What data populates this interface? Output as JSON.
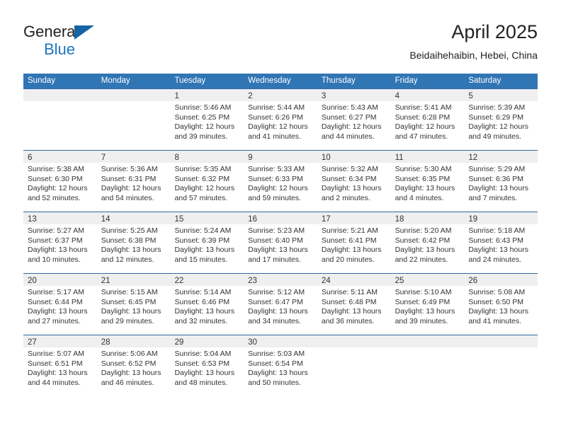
{
  "brand": {
    "name_part1": "General",
    "name_part2": "Blue",
    "triangle_color": "#1464a5",
    "blue_color": "#1c75bc"
  },
  "header": {
    "title": "April 2025",
    "subtitle": "Beidaihehaibin, Hebei, China",
    "header_bg": "#3075b4",
    "separator_color": "#2e6da4",
    "daynum_band_bg": "#efefef"
  },
  "weekdays": [
    "Sunday",
    "Monday",
    "Tuesday",
    "Wednesday",
    "Thursday",
    "Friday",
    "Saturday"
  ],
  "weeks": [
    [
      {
        "day": "",
        "lines": []
      },
      {
        "day": "",
        "lines": []
      },
      {
        "day": "1",
        "lines": [
          "Sunrise: 5:46 AM",
          "Sunset: 6:25 PM",
          "Daylight: 12 hours",
          "and 39 minutes."
        ]
      },
      {
        "day": "2",
        "lines": [
          "Sunrise: 5:44 AM",
          "Sunset: 6:26 PM",
          "Daylight: 12 hours",
          "and 41 minutes."
        ]
      },
      {
        "day": "3",
        "lines": [
          "Sunrise: 5:43 AM",
          "Sunset: 6:27 PM",
          "Daylight: 12 hours",
          "and 44 minutes."
        ]
      },
      {
        "day": "4",
        "lines": [
          "Sunrise: 5:41 AM",
          "Sunset: 6:28 PM",
          "Daylight: 12 hours",
          "and 47 minutes."
        ]
      },
      {
        "day": "5",
        "lines": [
          "Sunrise: 5:39 AM",
          "Sunset: 6:29 PM",
          "Daylight: 12 hours",
          "and 49 minutes."
        ]
      }
    ],
    [
      {
        "day": "6",
        "lines": [
          "Sunrise: 5:38 AM",
          "Sunset: 6:30 PM",
          "Daylight: 12 hours",
          "and 52 minutes."
        ]
      },
      {
        "day": "7",
        "lines": [
          "Sunrise: 5:36 AM",
          "Sunset: 6:31 PM",
          "Daylight: 12 hours",
          "and 54 minutes."
        ]
      },
      {
        "day": "8",
        "lines": [
          "Sunrise: 5:35 AM",
          "Sunset: 6:32 PM",
          "Daylight: 12 hours",
          "and 57 minutes."
        ]
      },
      {
        "day": "9",
        "lines": [
          "Sunrise: 5:33 AM",
          "Sunset: 6:33 PM",
          "Daylight: 12 hours",
          "and 59 minutes."
        ]
      },
      {
        "day": "10",
        "lines": [
          "Sunrise: 5:32 AM",
          "Sunset: 6:34 PM",
          "Daylight: 13 hours",
          "and 2 minutes."
        ]
      },
      {
        "day": "11",
        "lines": [
          "Sunrise: 5:30 AM",
          "Sunset: 6:35 PM",
          "Daylight: 13 hours",
          "and 4 minutes."
        ]
      },
      {
        "day": "12",
        "lines": [
          "Sunrise: 5:29 AM",
          "Sunset: 6:36 PM",
          "Daylight: 13 hours",
          "and 7 minutes."
        ]
      }
    ],
    [
      {
        "day": "13",
        "lines": [
          "Sunrise: 5:27 AM",
          "Sunset: 6:37 PM",
          "Daylight: 13 hours",
          "and 10 minutes."
        ]
      },
      {
        "day": "14",
        "lines": [
          "Sunrise: 5:25 AM",
          "Sunset: 6:38 PM",
          "Daylight: 13 hours",
          "and 12 minutes."
        ]
      },
      {
        "day": "15",
        "lines": [
          "Sunrise: 5:24 AM",
          "Sunset: 6:39 PM",
          "Daylight: 13 hours",
          "and 15 minutes."
        ]
      },
      {
        "day": "16",
        "lines": [
          "Sunrise: 5:23 AM",
          "Sunset: 6:40 PM",
          "Daylight: 13 hours",
          "and 17 minutes."
        ]
      },
      {
        "day": "17",
        "lines": [
          "Sunrise: 5:21 AM",
          "Sunset: 6:41 PM",
          "Daylight: 13 hours",
          "and 20 minutes."
        ]
      },
      {
        "day": "18",
        "lines": [
          "Sunrise: 5:20 AM",
          "Sunset: 6:42 PM",
          "Daylight: 13 hours",
          "and 22 minutes."
        ]
      },
      {
        "day": "19",
        "lines": [
          "Sunrise: 5:18 AM",
          "Sunset: 6:43 PM",
          "Daylight: 13 hours",
          "and 24 minutes."
        ]
      }
    ],
    [
      {
        "day": "20",
        "lines": [
          "Sunrise: 5:17 AM",
          "Sunset: 6:44 PM",
          "Daylight: 13 hours",
          "and 27 minutes."
        ]
      },
      {
        "day": "21",
        "lines": [
          "Sunrise: 5:15 AM",
          "Sunset: 6:45 PM",
          "Daylight: 13 hours",
          "and 29 minutes."
        ]
      },
      {
        "day": "22",
        "lines": [
          "Sunrise: 5:14 AM",
          "Sunset: 6:46 PM",
          "Daylight: 13 hours",
          "and 32 minutes."
        ]
      },
      {
        "day": "23",
        "lines": [
          "Sunrise: 5:12 AM",
          "Sunset: 6:47 PM",
          "Daylight: 13 hours",
          "and 34 minutes."
        ]
      },
      {
        "day": "24",
        "lines": [
          "Sunrise: 5:11 AM",
          "Sunset: 6:48 PM",
          "Daylight: 13 hours",
          "and 36 minutes."
        ]
      },
      {
        "day": "25",
        "lines": [
          "Sunrise: 5:10 AM",
          "Sunset: 6:49 PM",
          "Daylight: 13 hours",
          "and 39 minutes."
        ]
      },
      {
        "day": "26",
        "lines": [
          "Sunrise: 5:08 AM",
          "Sunset: 6:50 PM",
          "Daylight: 13 hours",
          "and 41 minutes."
        ]
      }
    ],
    [
      {
        "day": "27",
        "lines": [
          "Sunrise: 5:07 AM",
          "Sunset: 6:51 PM",
          "Daylight: 13 hours",
          "and 44 minutes."
        ]
      },
      {
        "day": "28",
        "lines": [
          "Sunrise: 5:06 AM",
          "Sunset: 6:52 PM",
          "Daylight: 13 hours",
          "and 46 minutes."
        ]
      },
      {
        "day": "29",
        "lines": [
          "Sunrise: 5:04 AM",
          "Sunset: 6:53 PM",
          "Daylight: 13 hours",
          "and 48 minutes."
        ]
      },
      {
        "day": "30",
        "lines": [
          "Sunrise: 5:03 AM",
          "Sunset: 6:54 PM",
          "Daylight: 13 hours",
          "and 50 minutes."
        ]
      },
      {
        "day": "",
        "lines": []
      },
      {
        "day": "",
        "lines": []
      },
      {
        "day": "",
        "lines": []
      }
    ]
  ]
}
